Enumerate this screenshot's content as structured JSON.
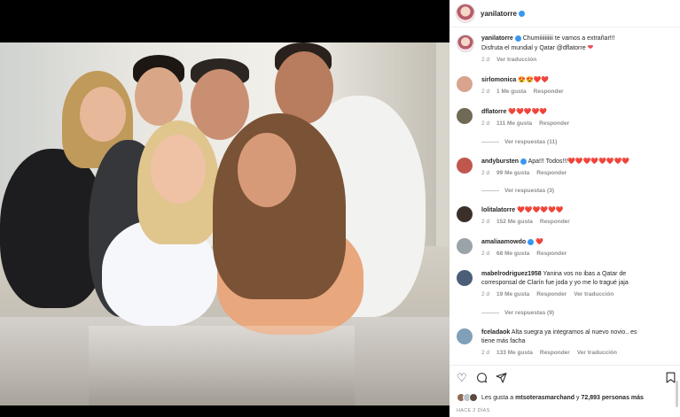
{
  "header": {
    "username": "yanilatorre"
  },
  "caption": {
    "username": "yanilatorre",
    "text_line1": "Chumiiiiiiiiii te vamos a extrañar!!!",
    "text_line2": "Disfruta el mundial y Qatar @dflatorre",
    "time": "2 d",
    "translate": "Ver traducción"
  },
  "comments": [
    {
      "user": "sirlomonica",
      "text": "😍😍❤️❤️",
      "time": "2 d",
      "likes": "1 Me gusta",
      "reply": "Responder",
      "avatar_color": "#d9a48f"
    },
    {
      "user": "dflatorre",
      "text": "❤️❤️❤️❤️❤️",
      "time": "2 d",
      "likes": "111 Me gusta",
      "reply": "Responder",
      "avatar_color": "#6f6a55",
      "replies": "Ver respuestas (11)"
    },
    {
      "user": "andybursten",
      "text": "Apa!!! Todos!!!❤️❤️❤️❤️❤️❤️❤️❤️",
      "time": "2 d",
      "likes": "99 Me gusta",
      "reply": "Responder",
      "avatar_color": "#c0574f",
      "replies": "Ver respuestas (3)"
    },
    {
      "user": "lolitalatorre",
      "text": "❤️❤️❤️❤️❤️❤️",
      "time": "2 d",
      "likes": "152 Me gusta",
      "reply": "Responder",
      "avatar_color": "#3b2f2a"
    },
    {
      "user": "amaliaamowdo",
      "text": "❤️",
      "time": "2 d",
      "likes": "68 Me gusta",
      "reply": "Responder",
      "avatar_color": "#9aa3a8"
    },
    {
      "user": "mabelrodriguez1958",
      "text_line1": "Yanina vos no ibas a Qatar de",
      "text_line2": "corresponsal de Clarín fue joda y yo me lo tragué jaja",
      "time": "2 d",
      "likes": "19 Me gusta",
      "reply": "Responder",
      "translate": "Ver traducción",
      "avatar_color": "#4b5e78",
      "replies": "Ver respuestas (9)"
    },
    {
      "user": "fceladaok",
      "text_line1": "Alta suegra ya integramos al nuevo novio.. es",
      "text_line2": "tiene más facha",
      "time": "2 d",
      "likes": "133 Me gusta",
      "reply": "Responder",
      "translate": "Ver traducción",
      "avatar_color": "#7fa0b8"
    }
  ],
  "likes_line": {
    "prefix": "Les gusta a",
    "user": "mtsoterasmarchand",
    "middle": "y",
    "count": "72,893 personas más"
  },
  "post_date": "HACE 2 DÍAS",
  "icons": [
    "heart-icon",
    "comment-icon",
    "share-icon",
    "bookmark-icon"
  ]
}
